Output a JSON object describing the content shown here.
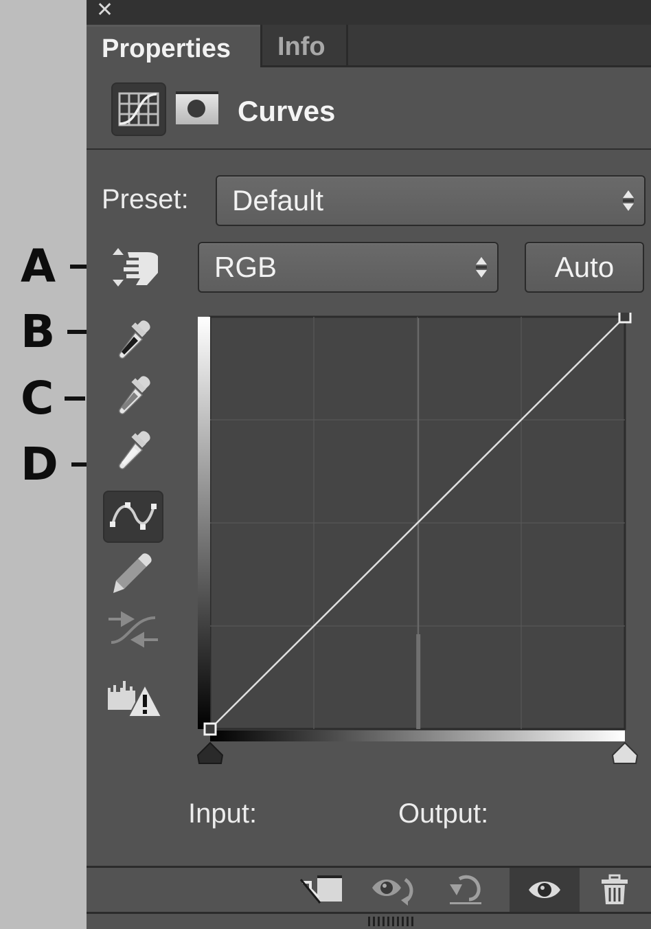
{
  "callouts": [
    {
      "letter": "A",
      "target": "targeted-adjustment-tool"
    },
    {
      "letter": "B",
      "target": "black-point-eyedropper"
    },
    {
      "letter": "C",
      "target": "gray-point-eyedropper"
    },
    {
      "letter": "D",
      "target": "white-point-eyedropper"
    }
  ],
  "window": {
    "close_glyph": "✕"
  },
  "tabs": [
    {
      "label": "Properties",
      "active": true
    },
    {
      "label": "Info",
      "active": false
    }
  ],
  "header": {
    "title": "Curves",
    "icons": [
      "curves-adjustment-icon",
      "layer-mask-icon"
    ]
  },
  "preset": {
    "label": "Preset:",
    "value": "Default"
  },
  "channel": {
    "value": "RGB"
  },
  "auto_button": "Auto",
  "tools": [
    {
      "name": "targeted-adjustment-tool",
      "icon": "hand-updown-icon",
      "selected": false
    },
    {
      "name": "black-point-eyedropper",
      "icon": "eyedropper-black-icon",
      "selected": false
    },
    {
      "name": "gray-point-eyedropper",
      "icon": "eyedropper-gray-icon",
      "selected": false
    },
    {
      "name": "white-point-eyedropper",
      "icon": "eyedropper-white-icon",
      "selected": false
    },
    {
      "name": "edit-points-tool",
      "icon": "curve-points-icon",
      "selected": true
    },
    {
      "name": "pencil-draw-tool",
      "icon": "pencil-icon",
      "selected": false
    },
    {
      "name": "smooth-curve-tool",
      "icon": "smooth-arrows-icon",
      "selected": false,
      "disabled": true
    },
    {
      "name": "clipping-warning-toggle",
      "icon": "histogram-warning-icon",
      "selected": false
    }
  ],
  "curve": {
    "grid_divisions": 4,
    "range": [
      0,
      255
    ],
    "points": [
      [
        0,
        0
      ],
      [
        255,
        255
      ]
    ],
    "histogram_spike_input": 128,
    "black_slider": 0,
    "white_slider": 255
  },
  "readout": {
    "input_label": "Input:",
    "output_label": "Output:"
  },
  "footer": {
    "buttons": [
      {
        "name": "clip-to-layer-button",
        "icon": "clip-layer-icon"
      },
      {
        "name": "view-previous-state-button",
        "icon": "eye-cycle-icon"
      },
      {
        "name": "reset-adjustments-button",
        "icon": "reset-icon"
      },
      {
        "name": "toggle-visibility-button",
        "icon": "eye-icon",
        "active": true
      },
      {
        "name": "delete-layer-button",
        "icon": "trash-icon"
      }
    ]
  }
}
